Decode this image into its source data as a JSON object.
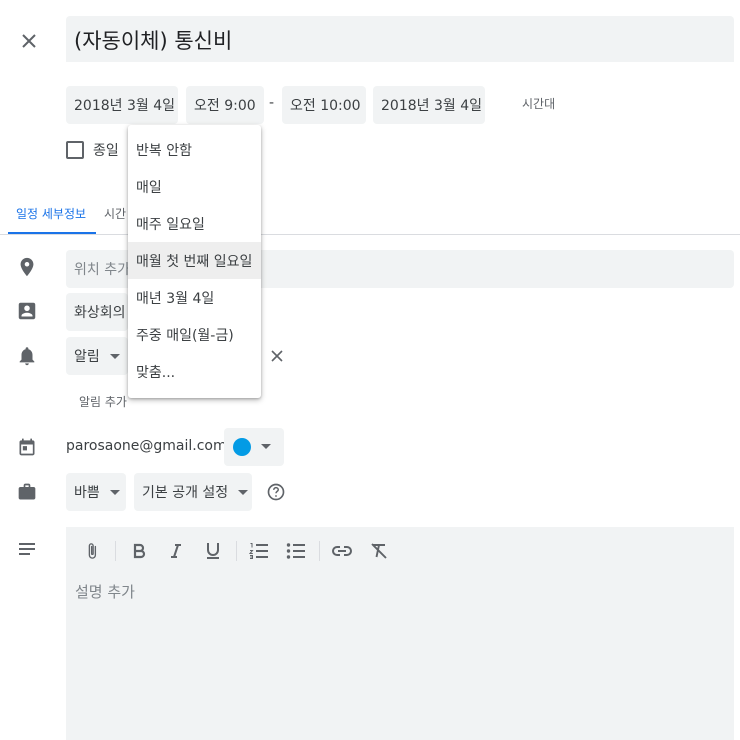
{
  "header": {
    "title": "(자동이체) 통신비"
  },
  "datetime": {
    "start_date": "2018년 3월 4일",
    "start_time": "오전 9:00",
    "separator": "-",
    "end_time": "오전 10:00",
    "end_date": "2018년 3월 4일",
    "timezone_label": "시간대"
  },
  "allday": {
    "label": "종일",
    "checked": false
  },
  "tabs": [
    {
      "label": "일정 세부정보",
      "active": true
    },
    {
      "label": "시간"
    }
  ],
  "location": {
    "placeholder": "위치 추가"
  },
  "conferencing": {
    "label": "화상회의"
  },
  "notification": {
    "type_label": "알림",
    "add_label": "알림 추가"
  },
  "calendar": {
    "owner": "parosaone@gmail.com",
    "color": "#039be5"
  },
  "availability": {
    "busy_label": "바쁨",
    "visibility_label": "기본 공개 설정"
  },
  "description": {
    "placeholder": "설명 추가"
  },
  "repeat_menu": {
    "items": [
      {
        "label": "반복 안함"
      },
      {
        "label": "매일"
      },
      {
        "label": "매주 일요일"
      },
      {
        "label": "매월 첫 번째 일요일",
        "highlighted": true
      },
      {
        "label": "매년 3월 4일"
      },
      {
        "label": "주중 매일(월-금)"
      },
      {
        "label": "맞춤..."
      }
    ]
  },
  "colors": {
    "accent": "#1a73e8",
    "field_bg": "#f1f3f4",
    "icon": "#5f6368"
  }
}
